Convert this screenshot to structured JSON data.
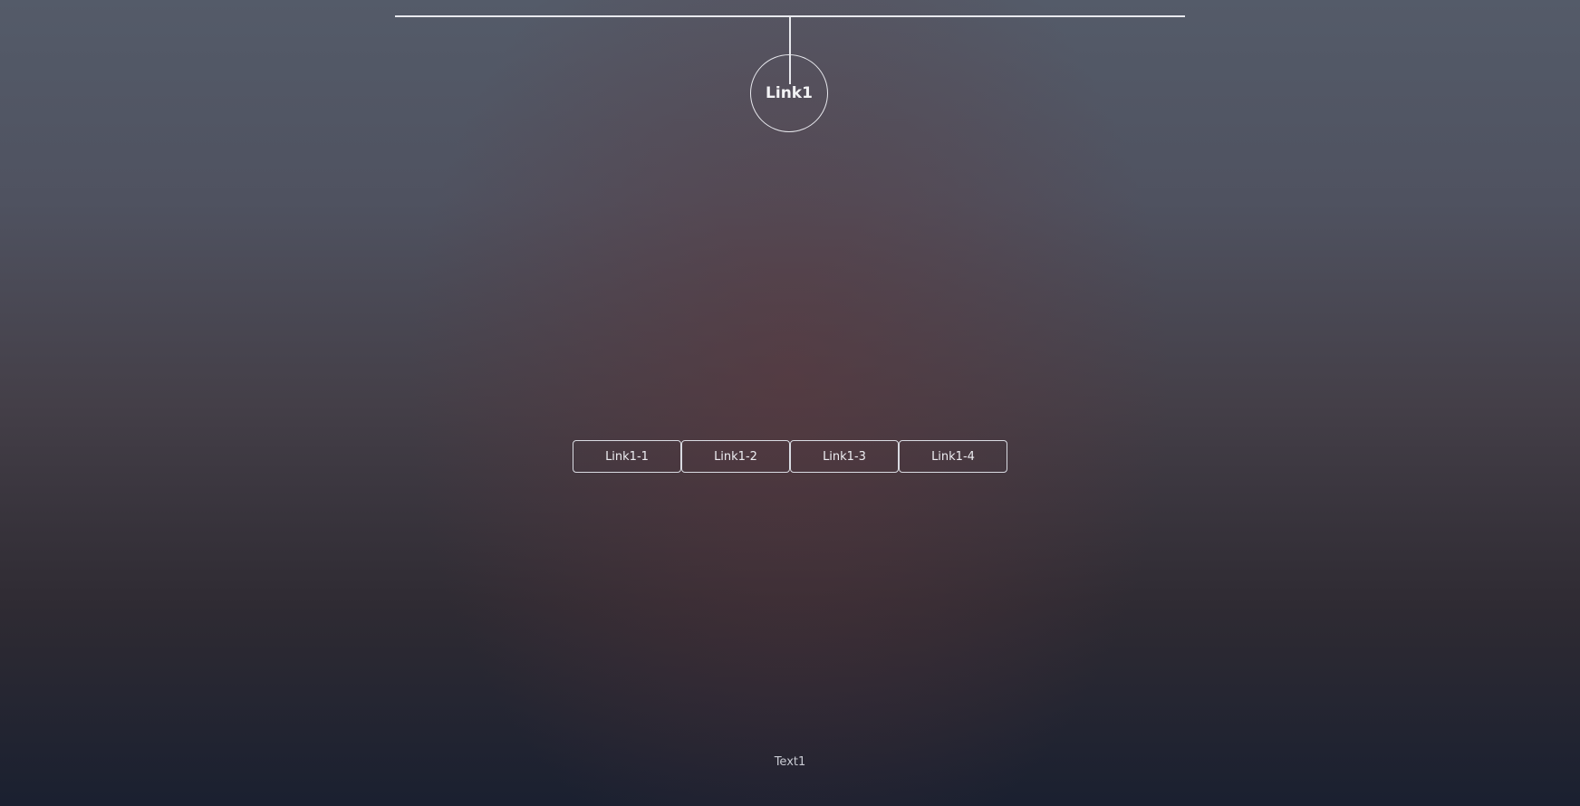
{
  "nav": {
    "main_link": "Link1",
    "sub_links": [
      "Link1-1",
      "Link1-2",
      "Link1-3",
      "Link1-4"
    ]
  },
  "footer": {
    "text": "Text1"
  },
  "colors": {
    "line": "#e8e9ee",
    "text": "#f0f0f2"
  }
}
